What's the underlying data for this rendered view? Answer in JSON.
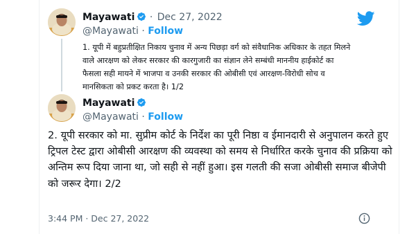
{
  "colors": {
    "accent": "#1d9bf0",
    "muted": "#536471",
    "text": "#0f1419"
  },
  "tweet1": {
    "name": "Mayawati",
    "separator": "·",
    "date": "Dec 27, 2022",
    "handle": "@Mayawati",
    "follow_separator": " · ",
    "follow": "Follow",
    "text": "1. यूपी में बहुप्रतीक्षित निकाय चुनाव में अन्य पिछड़ा वर्ग को संवैधानिक अधिकार के तहत मिलने वाले आरक्षण को लेकर सरकार की कारगुजारी का संज्ञान लेने सम्बंधी माननीय हाईकोर्ट का फैसला सही मायने में भाजपा व उनकी सरकार की ओबीसी एवं आरक्षण-विरोधी सोच व मानसिकता को प्रकट करता है। 1/2"
  },
  "tweet2": {
    "name": "Mayawati",
    "handle": "@Mayawati",
    "follow_separator": " · ",
    "follow": "Follow",
    "text": "2. यूपी सरकार को मा. सुप्रीम कोर्ट के निर्देश का पूरी निष्ठा व ईमानदारी से अनुपालन करते हुए ट्रिपल टेस्ट द्वारा ओबीसी आरक्षण की व्यवस्था को समय से निर्धारित करके चुनाव की प्रक्रिया को अन्तिम रूप दिया जाना था, जो सही से नहीं हुआ। इस गलती की सजा ओबीसी समाज बीजेपी को जरूर देगा। 2/2",
    "timestamp": "3:44 PM · Dec 27, 2022"
  },
  "icons": {
    "verified": "verified-badge-icon",
    "brand": "twitter-bird-icon",
    "info": "info-icon"
  }
}
